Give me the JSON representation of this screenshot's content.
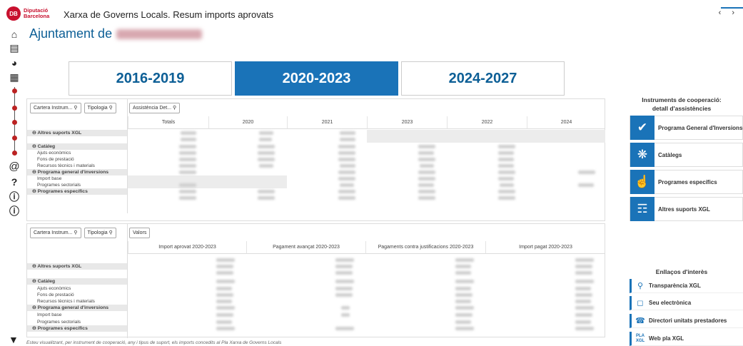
{
  "header": {
    "logo_line1": "Diputació",
    "logo_line2": "Barcelona",
    "app_title": "Xarxa de Governs Locals. Resum imports aprovats",
    "nav_arrows": "‹ ›"
  },
  "page": {
    "title": "Ajuntament de"
  },
  "side_icons": [
    "home-icon",
    "institution-icon",
    "gauge-icon",
    "calendar-icon",
    "at-icon",
    "question-icon",
    "info-icon",
    "info-icon"
  ],
  "period_tabs": [
    {
      "label": "2016-2019",
      "active": false
    },
    {
      "label": "2020-2023",
      "active": true
    },
    {
      "label": "2024-2027",
      "active": false
    }
  ],
  "table1": {
    "filters": [
      "Cartera Instrum...",
      "Tipologia"
    ],
    "filter_col": "Assistència Det...",
    "headers": [
      "Totals",
      "2020",
      "2021",
      "2023",
      "2022",
      "2024"
    ],
    "rows": [
      {
        "label": "Altres suports XGL",
        "group": true
      },
      {
        "label": "",
        "group": false
      },
      {
        "label": "Catàleg",
        "group": true
      },
      {
        "label": "Ajuts econòmics",
        "group": false
      },
      {
        "label": "Fons de prestació",
        "group": false
      },
      {
        "label": "Recursos tècnics i materials",
        "group": false
      },
      {
        "label": "Programa general d'inversions",
        "group": true
      },
      {
        "label": "Import base",
        "group": false
      },
      {
        "label": "Programes sectorials",
        "group": false
      },
      {
        "label": "Programes específics",
        "group": true
      }
    ]
  },
  "table2": {
    "filters": [
      "Cartera Instrum...",
      "Tipologia"
    ],
    "filter_col": "Valors",
    "headers": [
      "Import aprovat 2020-2023",
      "Pagament avançat 2020-2023",
      "Pagaments contra justificacions 2020-2023",
      "Import pagat 2020-2023"
    ],
    "rows": [
      {
        "label": "Altres suports XGL",
        "group": true
      },
      {
        "label": "",
        "group": false
      },
      {
        "label": "Catàleg",
        "group": true
      },
      {
        "label": "Ajuts econòmics",
        "group": false
      },
      {
        "label": "Fons de prestació",
        "group": false
      },
      {
        "label": "Recursos tècnics i materials",
        "group": false
      },
      {
        "label": "Programa general d'inversions",
        "group": true
      },
      {
        "label": "Import base",
        "group": false
      },
      {
        "label": "Programes sectorials",
        "group": false
      },
      {
        "label": "Programes específics",
        "group": true
      }
    ]
  },
  "footnote": "Esteu visualitzant, per instrument de cooperació, any i tipus de suport, els imports concedits al Pla Xarxa de Governs Locals",
  "right_panel": {
    "instruments_title_1": "Instruments de cooperació:",
    "instruments_title_2": "detall d'assistències",
    "instruments": [
      {
        "label": "Programa General d'Inversions",
        "icon": "checkmark-icon"
      },
      {
        "label": "Catàlegs",
        "icon": "catalog-icon"
      },
      {
        "label": "Programes específics",
        "icon": "hand-touch-icon"
      },
      {
        "label": "Altres suports XGL",
        "icon": "open-book-icon"
      }
    ],
    "links_title": "Enllaços d'interès",
    "links": [
      {
        "label": "Transparència XGL",
        "icon": "search-icon"
      },
      {
        "label": "Seu electrònica",
        "icon": "mouse-icon"
      },
      {
        "label": "Directori unitats prestadores",
        "icon": "phone-icon"
      },
      {
        "label": "Web pla XGL",
        "icon": "pla-xgl-icon",
        "icon_text": "PLA XGL"
      }
    ]
  }
}
